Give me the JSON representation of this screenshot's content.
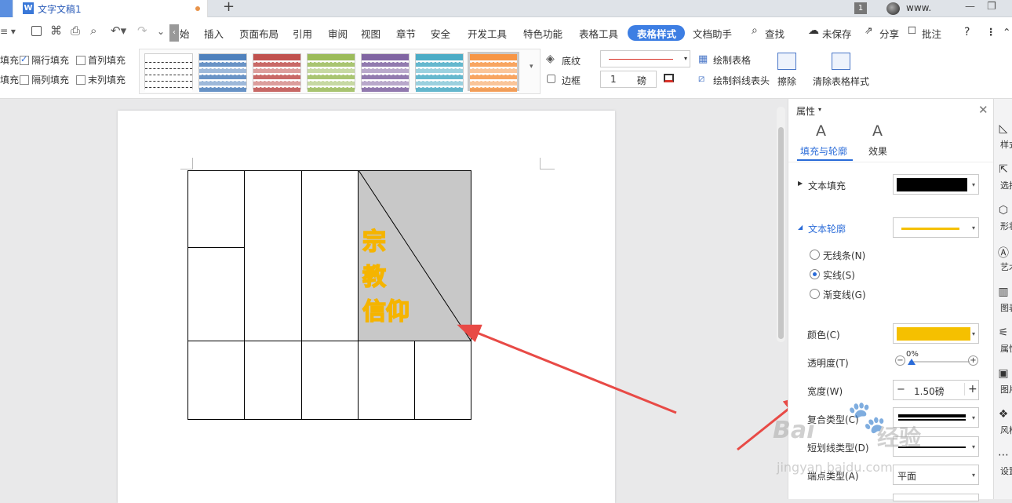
{
  "titlebar": {
    "doc_tab": "文字文稿1",
    "page_badge": "1",
    "user": "www.",
    "new_tab": "+",
    "min": "—",
    "restore": "❐"
  },
  "menu": {
    "items": [
      "插入",
      "页面布局",
      "引用",
      "审阅",
      "视图",
      "章节",
      "安全",
      "开发工具",
      "特色功能",
      "表格工具",
      "表格样式",
      "文档助手"
    ],
    "active": "表格样式",
    "partial": "始",
    "search": "查找",
    "unsaved": "未保存",
    "share": "分享",
    "comment": "批注",
    "help": "?"
  },
  "ribbon": {
    "row_fill_left1": "填充",
    "row_fill_left2": "填充",
    "alt_row": "隔行填充",
    "alt_row_checked": true,
    "first_col": "首列填充",
    "alt_col": "隔列填充",
    "last_col": "末列填充",
    "shading": "底纹",
    "border": "边框",
    "line_weight": "1",
    "line_unit": "磅",
    "draw_table": "绘制表格",
    "draw_diag": "绘制斜线表头",
    "erase": "擦除",
    "clear_style": "清除表格样式",
    "style_colors": [
      "#ffffff",
      "#4f81bd",
      "#c0504d",
      "#9bbb59",
      "#8064a2",
      "#4bacc6",
      "#f79646"
    ]
  },
  "document": {
    "cell_text": [
      "宗",
      "教",
      "信仰"
    ]
  },
  "panel": {
    "title": "属性",
    "tab_fill": "填充与轮廓",
    "tab_effect": "效果",
    "text_fill": "文本填充",
    "text_fill_color": "#000000",
    "text_outline": "文本轮廓",
    "outline_color": "#f5c000",
    "opt_none": "无线条(N)",
    "opt_solid": "实线(S)",
    "opt_grad": "渐变线(G)",
    "color_label": "颜色(C)",
    "transparency_label": "透明度(T)",
    "transparency_value": "0%",
    "width_label": "宽度(W)",
    "width_value": "1.50磅",
    "compound_label": "复合类型(C)",
    "dash_label": "短划线类型(D)",
    "cap_label": "端点类型(A)",
    "cap_value": "平面"
  },
  "sidebar": [
    "样式",
    "选择",
    "形状",
    "艺术",
    "图表",
    "属性",
    "图片",
    "风格",
    "设置"
  ],
  "watermark": {
    "brand": "Bai",
    "text": "经验",
    "url": "jingyan.baidu.com"
  }
}
